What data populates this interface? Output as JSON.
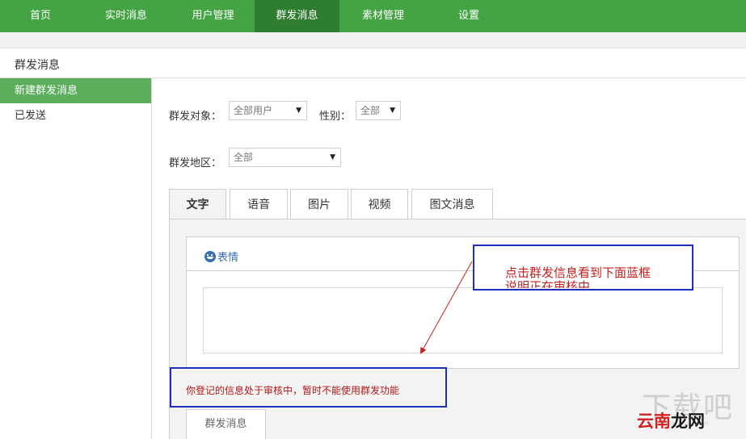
{
  "topnav": {
    "items": [
      {
        "label": "首页"
      },
      {
        "label": "实时消息"
      },
      {
        "label": "用户管理"
      },
      {
        "label": "群发消息",
        "active": true
      },
      {
        "label": "素材管理"
      },
      {
        "label": "设置"
      }
    ]
  },
  "page": {
    "title": "群发消息"
  },
  "sidebar": {
    "items": [
      {
        "label": "新建群发消息",
        "active": true
      },
      {
        "label": "已发送"
      }
    ]
  },
  "form": {
    "target_label": "群发对象：",
    "target_value": "全部用户",
    "gender_label": "性别：",
    "gender_value": "全部",
    "region_label": "群发地区：",
    "region_value": "全部"
  },
  "tabs": [
    {
      "label": "文字",
      "active": true
    },
    {
      "label": "语音"
    },
    {
      "label": "图片"
    },
    {
      "label": "视频"
    },
    {
      "label": "图文消息"
    }
  ],
  "editor": {
    "emoji_label": "表情",
    "text_value": ""
  },
  "notice": {
    "text": "你登记的信息处于审核中，暂时不能使用群发功能"
  },
  "send_button": {
    "label": "群发消息"
  },
  "annotation": {
    "line1": "点击群发信息看到下面蓝框",
    "line2": "说明正在审核中"
  },
  "watermark": {
    "big": "下载吧",
    "small": "www.xiazaiba.com",
    "logo_red": "云南",
    "logo_rest": "龙网"
  },
  "colors": {
    "nav_green": "#44a444",
    "nav_active": "#2f7d2f",
    "sidebar_active": "#5cae5c",
    "annotation_blue": "#1e2fbf",
    "annotation_red": "#c42020"
  },
  "icons": {
    "emoji": "smiley-face-icon",
    "dropdown": "triangle-down-icon"
  }
}
